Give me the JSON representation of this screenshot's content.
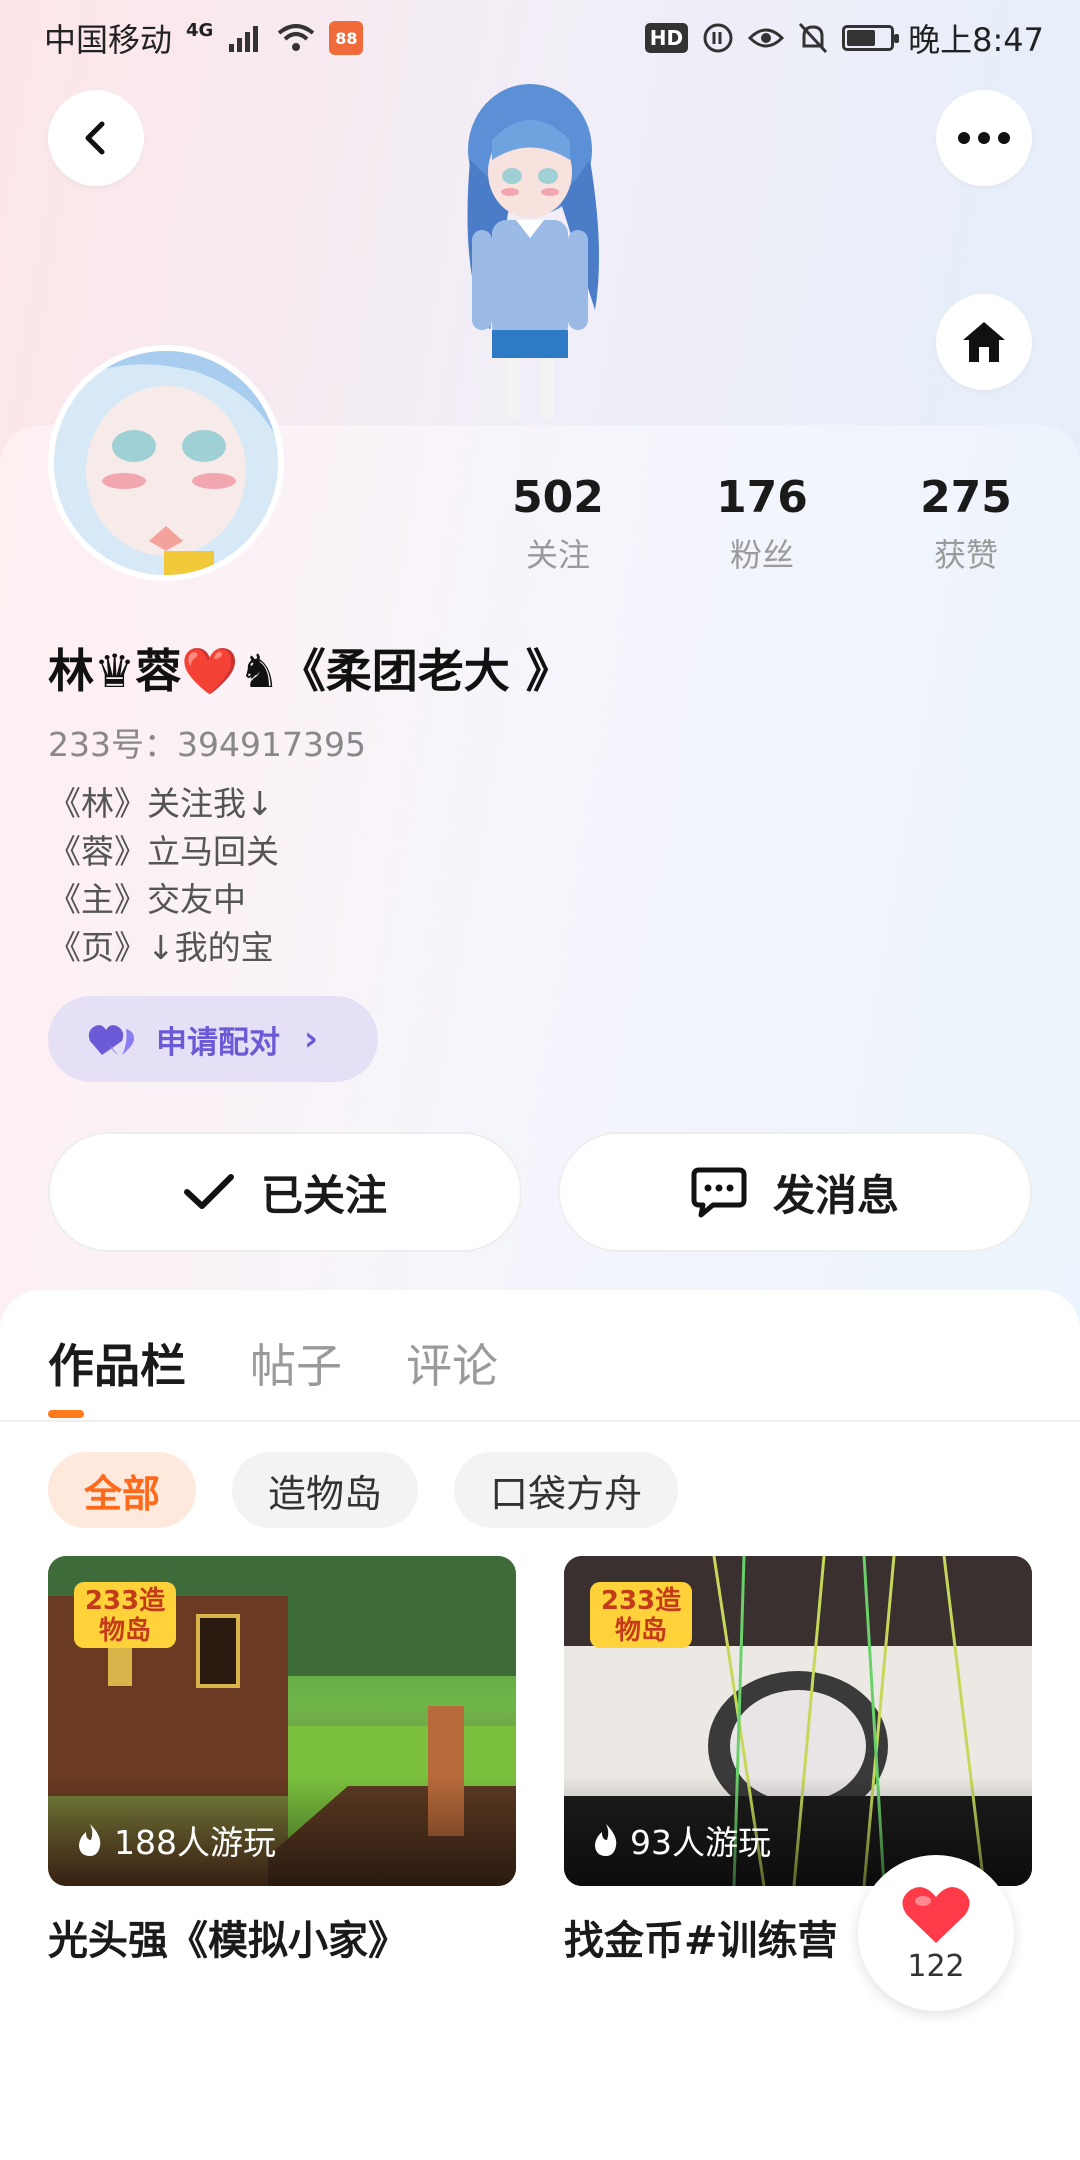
{
  "status_bar": {
    "carrier": "中国移动",
    "network": "4G",
    "time": "晚上8:47",
    "hd_label": "HD"
  },
  "stats": [
    {
      "value": "502",
      "label": "关注"
    },
    {
      "value": "176",
      "label": "粉丝"
    },
    {
      "value": "275",
      "label": "获赞"
    }
  ],
  "profile": {
    "username": "林♛蓉❤️♞《柔团老大 》",
    "uid": "233号：394917395",
    "bio": [
      "《林》关注我↓",
      "《蓉》立马回关",
      "《主》交友中",
      "《页》↓我的宝"
    ]
  },
  "pair_button": {
    "label": "申请配对"
  },
  "actions": {
    "follow_label": "已关注",
    "message_label": "发消息"
  },
  "tabs": [
    {
      "label": "作品栏",
      "active": true
    },
    {
      "label": "帖子",
      "active": false
    },
    {
      "label": "评论",
      "active": false
    }
  ],
  "filters": [
    {
      "label": "全部",
      "active": true
    },
    {
      "label": "造物岛",
      "active": false
    },
    {
      "label": "口袋方舟",
      "active": false
    }
  ],
  "works": [
    {
      "badge": "233造物岛",
      "plays": "188人游玩",
      "title": "光头强《模拟小家》"
    },
    {
      "badge": "233造物岛",
      "plays": "93人游玩",
      "title": "找金币#训练营"
    }
  ],
  "like_fab": {
    "count": "122"
  },
  "colors": {
    "accent": "#ff7a1a",
    "pair": "#6a5ad6",
    "heart": "#ff3b4a"
  }
}
